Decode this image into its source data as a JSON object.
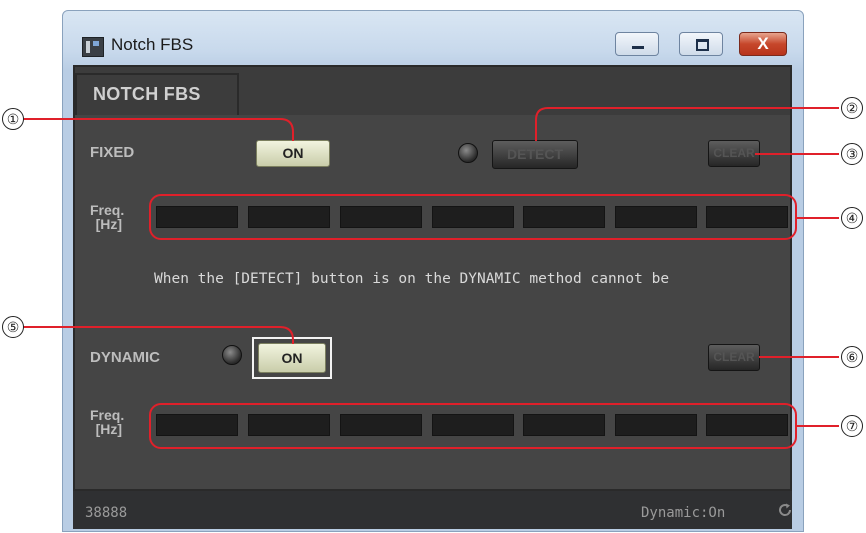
{
  "window": {
    "title": "Notch FBS",
    "close_label": "X"
  },
  "panel": {
    "tab_label": "NOTCH FBS",
    "fixed": {
      "label": "FIXED",
      "on_label": "ON",
      "detect_label": "DETECT",
      "clear_label": "CLEAR",
      "freq_label_line1": "Freq.",
      "freq_label_line2": "[Hz]",
      "freq_values": [
        "",
        "",
        "",
        "",
        "",
        "",
        ""
      ]
    },
    "note": "When the [DETECT] button is on the DYNAMIC method cannot be",
    "dynamic": {
      "label": "DYNAMIC",
      "on_label": "ON",
      "clear_label": "CLEAR",
      "freq_label_line1": "Freq.",
      "freq_label_line2": "[Hz]",
      "freq_values": [
        "",
        "",
        "",
        "",
        "",
        "",
        ""
      ]
    }
  },
  "statusbar": {
    "left_text": "38888",
    "right_text": "Dynamic:On"
  },
  "callouts": [
    "①",
    "②",
    "③",
    "④",
    "⑤",
    "⑥",
    "⑦"
  ],
  "colors": {
    "highlight": "#e0202a",
    "panel_bg": "#454545",
    "button_on": "#e4e7c8",
    "close_button": "#c6472b"
  },
  "icons": {
    "app": "app-icon",
    "minimize": "minimize-icon",
    "maximize": "maximize-icon",
    "close": "close-icon",
    "refresh": "refresh-icon"
  }
}
